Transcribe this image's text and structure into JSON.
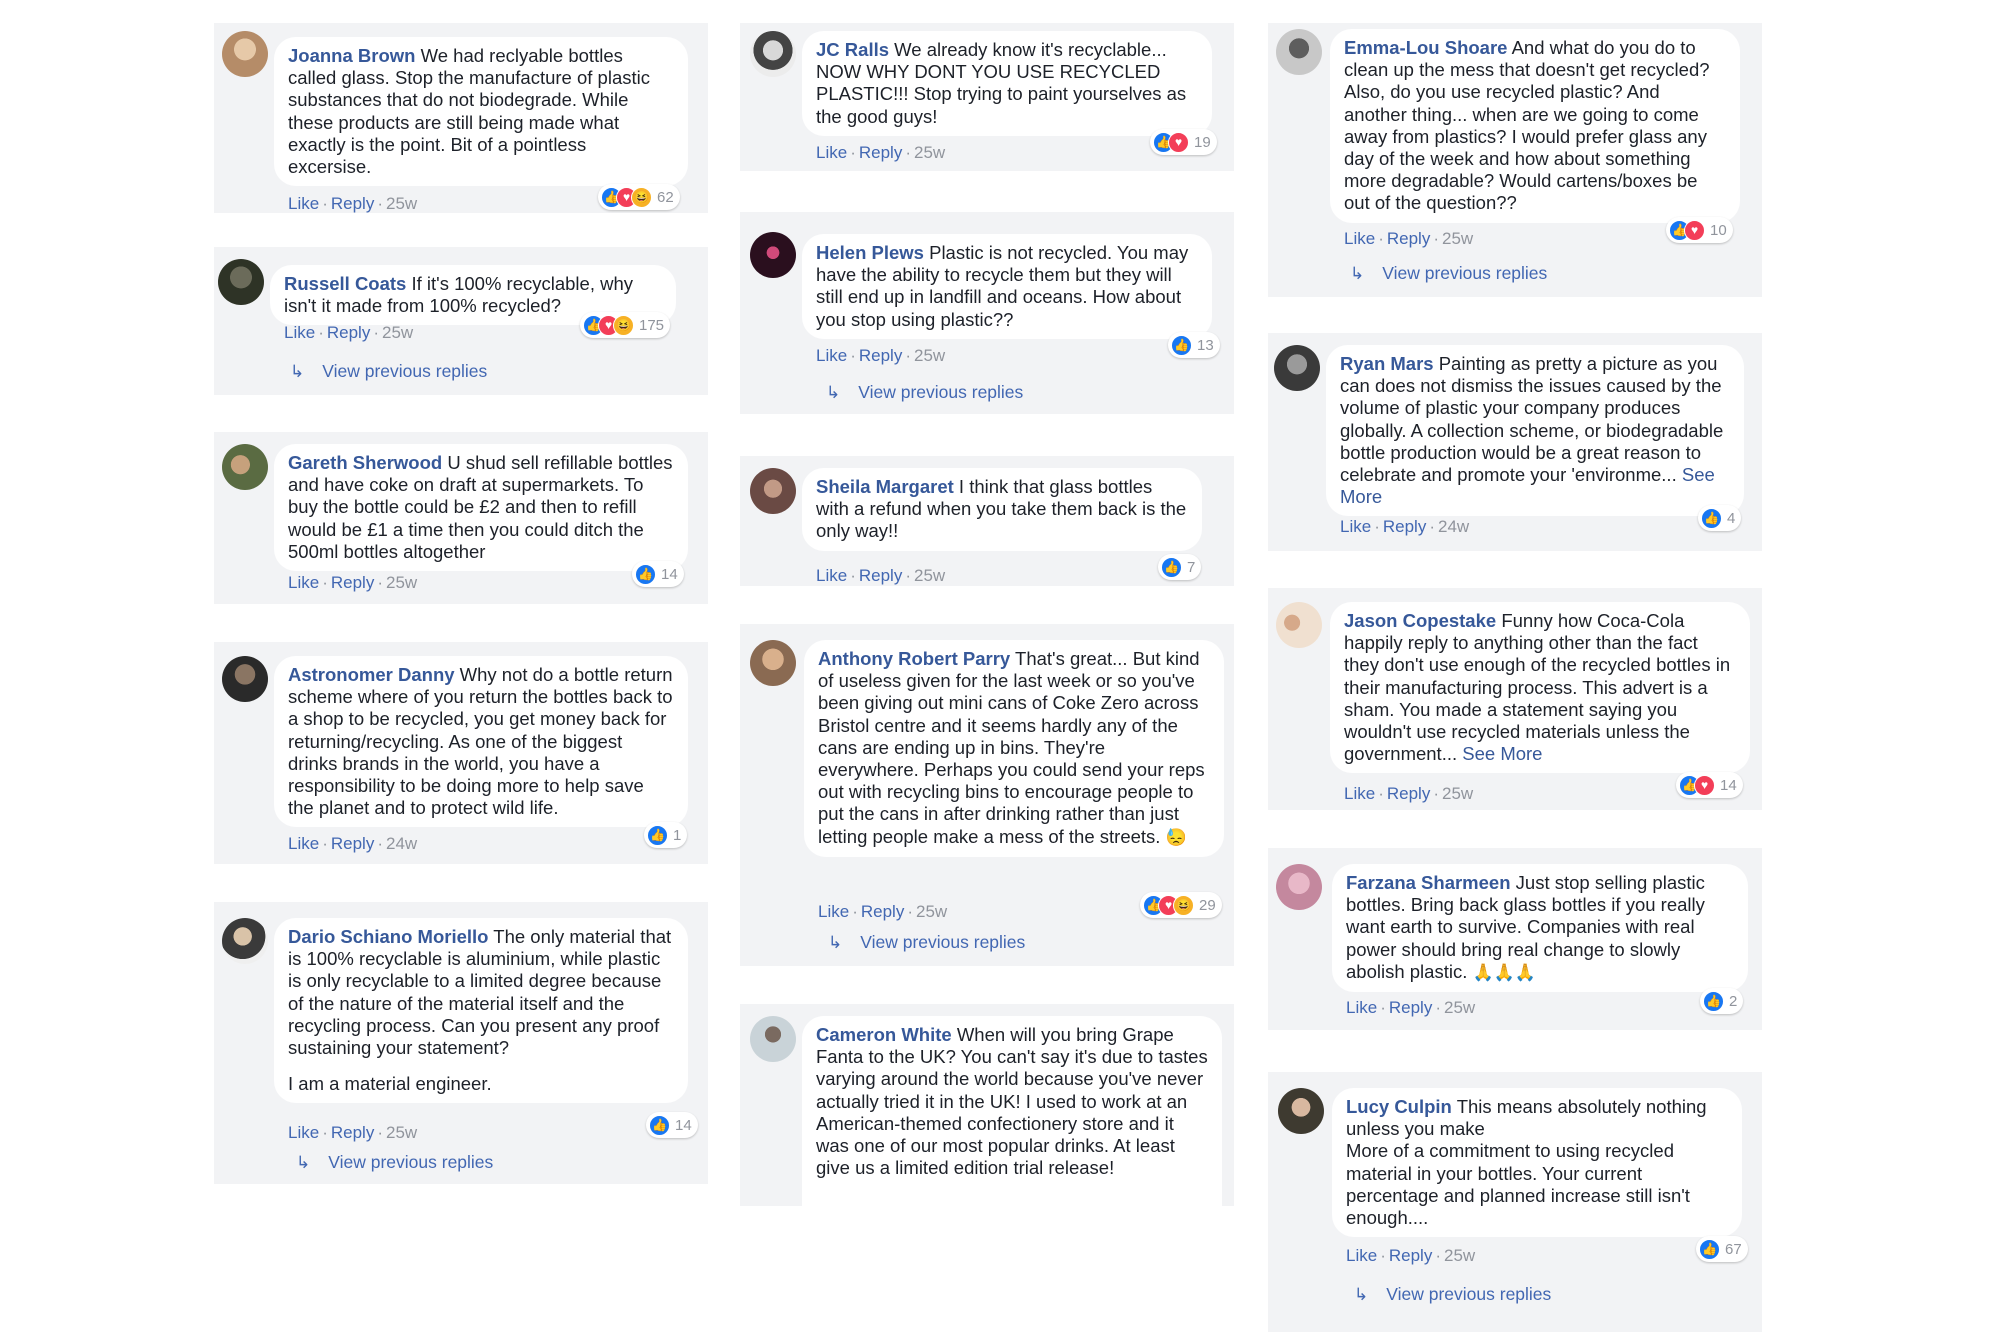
{
  "labels": {
    "like": "Like",
    "reply": "Reply",
    "dot": "·",
    "see_more": "See More",
    "view_previous_replies": "View previous replies"
  },
  "comments": [
    {
      "name": "Joanna Brown",
      "text": "We had reclyable bottles called glass. Stop the manufacture of plastic substances that do not biodegrade. While these products are still being made what exactly is the point. Bit of a pointless excersise.",
      "reactions": [
        "like",
        "love",
        "haha"
      ],
      "count": "62",
      "time": "25w"
    },
    {
      "name": "Russell Coats",
      "text": "If it's 100% recyclable, why isn't it made from 100% recycled?",
      "reactions": [
        "like",
        "love",
        "haha"
      ],
      "count": "175",
      "time": "25w"
    },
    {
      "name": "Gareth Sherwood",
      "text": "U shud sell refillable bottles and have coke on draft at supermarkets. To buy the bottle could be £2 and then to refill would be £1 a time then you could ditch the 500ml bottles altogether",
      "reactions": [
        "like"
      ],
      "count": "14",
      "time": "25w"
    },
    {
      "name": "Astronomer Danny",
      "text": "Why not do a bottle return scheme where of you return the bottles back to a shop to be recycled, you get money back for returning/recycling. As one of the biggest drinks brands in the world, you have a responsibility to be doing more to help save the planet and to protect wild life.",
      "reactions": [
        "like"
      ],
      "count": "1",
      "time": "24w"
    },
    {
      "name": "Dario Schiano Moriello",
      "text": "The only material that is 100% recyclable is aluminium, while plastic is only recyclable to a limited degree because of the nature of the material itself and the recycling process. Can you present any proof sustaining your statement?",
      "text2": "I am a material engineer.",
      "reactions": [
        "like"
      ],
      "count": "14",
      "time": "25w"
    },
    {
      "name": "JC Ralls",
      "text": "We already know it's recyclable... NOW WHY DONT YOU USE RECYCLED PLASTIC!!! Stop trying to paint yourselves as the good guys!",
      "reactions": [
        "like",
        "love"
      ],
      "count": "19",
      "time": "25w"
    },
    {
      "name": "Helen Plews",
      "text": "Plastic is not recycled. You may have the ability to recycle them but they will still end up in landfill and oceans. How about you stop using plastic??",
      "reactions": [
        "like"
      ],
      "count": "13",
      "time": "25w"
    },
    {
      "name": "Sheila Margaret",
      "text": "I think that glass bottles with a refund when you take them back is the only way!!",
      "reactions": [
        "like"
      ],
      "count": "7",
      "time": "25w"
    },
    {
      "name": "Anthony Robert Parry",
      "text": "That's great... But kind of useless given for the last week or so you've been giving out mini cans of Coke Zero across Bristol centre and it seems hardly any of the cans are ending up in bins. They're everywhere. Perhaps you could send your reps out with recycling bins to encourage people to put the cans in after drinking rather than just letting people make a mess of the streets.",
      "emoji": "😓",
      "reactions": [
        "like",
        "love",
        "haha"
      ],
      "count": "29",
      "time": "25w"
    },
    {
      "name": "Cameron White",
      "text": "When will you bring Grape Fanta to the UK? You can't say it's due to tastes varying around the world because you've never actually tried it in the UK! I used to work at an American-themed confectionery store and it was one of our most popular drinks. At least give us a limited edition trial release!"
    },
    {
      "name": "Emma-Lou Shoare",
      "text": "And what do you do to clean up the mess that doesn't get recycled? Also, do you use recycled plastic? And another thing... when are we going to come away from plastics? I would prefer glass any day of the week and how about something more degradable? Would cartens/boxes be out of the question??",
      "reactions": [
        "like",
        "love"
      ],
      "count": "10",
      "time": "25w"
    },
    {
      "name": "Ryan Mars",
      "text": "Painting as pretty a picture as you can does not dismiss the issues caused by the volume of plastic your company produces globally. A collection scheme, or biodegradable bottle production would be a great reason to celebrate and promote your 'environme...",
      "reactions": [
        "like"
      ],
      "count": "4",
      "time": "24w"
    },
    {
      "name": "Jason Copestake",
      "text": "Funny how Coca-Cola happily reply to anything other than the fact they don't use enough of the recycled bottles in their manufacturing process. This advert is a sham. You made a statement saying you wouldn't use recycled materials unless the government...",
      "reactions": [
        "like",
        "love"
      ],
      "count": "14",
      "time": "25w"
    },
    {
      "name": "Farzana Sharmeen",
      "text": "Just stop selling plastic bottles. Bring back glass bottles if you really want earth to survive. Companies with real power should bring real change to slowly abolish plastic.",
      "emoji": "🙏🙏🙏",
      "reactions": [
        "like"
      ],
      "count": "2",
      "time": "25w"
    },
    {
      "name": "Lucy Culpin",
      "text": "This means absolutely nothing unless you make",
      "text2": "More of a commitment to using recycled material in your bottles. Your current percentage and planned increase still isn't enough....",
      "reactions": [
        "like"
      ],
      "count": "67",
      "time": "25w"
    }
  ],
  "colors": {
    "panel": "#f2f3f5",
    "name": "#365899",
    "link": "#4267b2",
    "meta": "#90949c",
    "like": "#1877f2",
    "love": "#f33e58",
    "haha": "#f7b125"
  }
}
